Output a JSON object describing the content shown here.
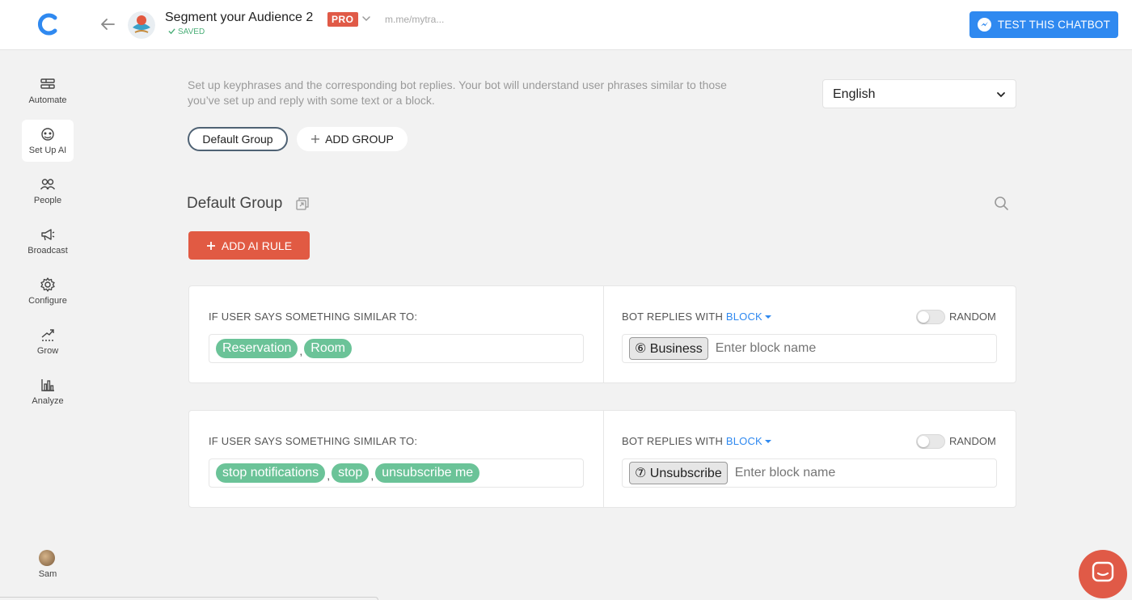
{
  "header": {
    "bot_name": "Segment your Audience 2",
    "pro_badge": "PRO",
    "bot_url": "m.me/mytra...",
    "saved_status": "SAVED",
    "test_button": "TEST THIS CHATBOT"
  },
  "sidebar": {
    "items": [
      {
        "label": "Automate",
        "icon": "automate-icon"
      },
      {
        "label": "Set Up AI",
        "icon": "ai-icon",
        "active": true
      },
      {
        "label": "People",
        "icon": "people-icon"
      },
      {
        "label": "Broadcast",
        "icon": "megaphone-icon"
      },
      {
        "label": "Configure",
        "icon": "gear-icon"
      },
      {
        "label": "Grow",
        "icon": "grow-icon"
      },
      {
        "label": "Analyze",
        "icon": "chart-icon"
      }
    ],
    "user": {
      "name": "Sam"
    }
  },
  "main": {
    "description": "Set up keyphrases and the corresponding bot replies. Your bot will understand user phrases similar to those you’ve set up and reply with some text or a block.",
    "language": "English",
    "groups": [
      {
        "label": "Default Group",
        "active": true
      }
    ],
    "add_group_label": "ADD GROUP",
    "group_title": "Default Group",
    "add_rule_label": "ADD AI RULE",
    "rules": [
      {
        "left_label": "IF USER SAYS SOMETHING SIMILAR TO:",
        "phrases": [
          "Reservation",
          "Room"
        ],
        "right_label_prefix": "BOT REPLIES WITH",
        "right_label_link": "BLOCK",
        "random_label": "RANDOM",
        "random_on": false,
        "block": {
          "number": "⑥",
          "name": "Business"
        },
        "block_placeholder": "Enter block name"
      },
      {
        "left_label": "IF USER SAYS SOMETHING SIMILAR TO:",
        "phrases": [
          "stop notifications",
          "stop",
          "unsubscribe me"
        ],
        "right_label_prefix": "BOT REPLIES WITH",
        "right_label_link": "BLOCK",
        "random_label": "RANDOM",
        "random_on": false,
        "block": {
          "number": "⑦",
          "name": "Unsubscribe"
        },
        "block_placeholder": "Enter block name"
      }
    ]
  },
  "colors": {
    "accent_blue": "#2f89f0",
    "accent_red": "#e15a43",
    "chip_green": "#6bc398",
    "saved_green": "#4caf79"
  }
}
